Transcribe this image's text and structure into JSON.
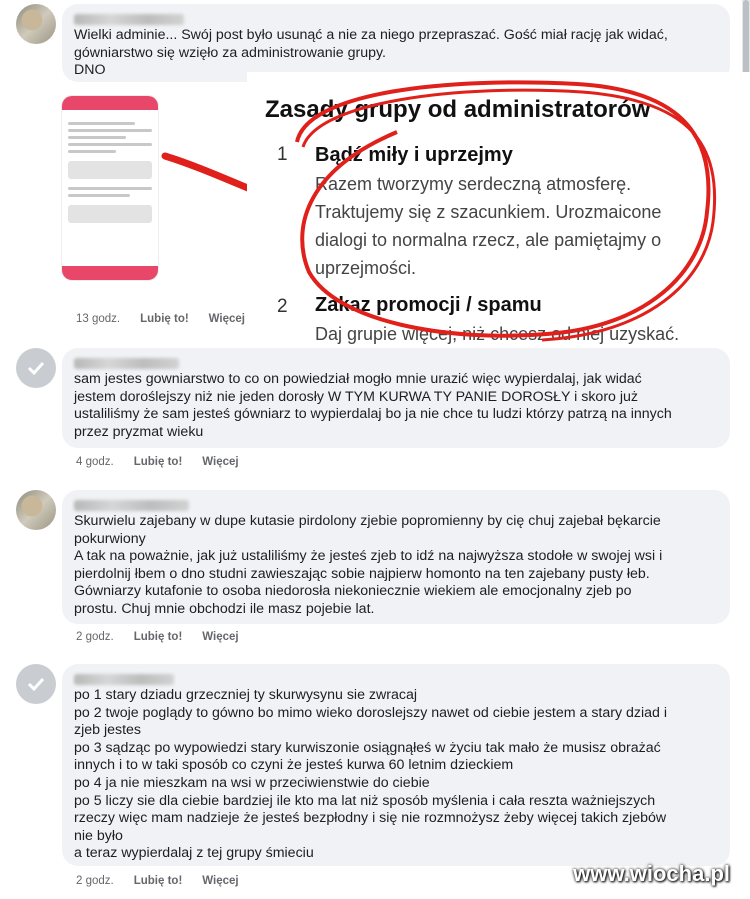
{
  "comments": [
    {
      "avatar": "photo",
      "text": "Wielki adminie... Swój post było usunąć a nie za niego przepraszać. Gość miał rację jak widać,\ngówniarstwo się wzięło za administrowanie grupy.\nDNO",
      "time": "13 godz.",
      "like": "Lubię to!",
      "more": "Więcej"
    },
    {
      "avatar": "default",
      "text": "sam jestes gowniarstwo to co on powiedział mogło mnie urazić więc wypierdalaj, jak widać\njestem doroślejszy niż nie jeden dorosły W TYM KURWA TY PANIE DOROSŁY i skoro już\nustaliliśmy że sam jesteś gówniarz to wypierdalaj bo ja nie chce tu ludzi którzy patrzą na innych\nprzez pryzmat wieku",
      "time": "4 godz.",
      "like": "Lubię to!",
      "more": "Więcej"
    },
    {
      "avatar": "photo",
      "text": "Skurwielu zajebany w dupe kutasie pirdolony zjebie popromienny by cię chuj zajebał bękarcie\npokurwiony\nA tak na poważnie, jak już ustaliliśmy że jesteś zjeb to idź na najwyższa stodołe w swojej wsi i\npierdolnij łbem o dno studni zawieszając sobie najpierw homonto na ten zajebany pusty łeb.\nGówniarzy kutafonie to osoba niedorosła niekoniecznie wiekiem ale emocjonalny zjeb po\nprostu. Chuj mnie obchodzi ile masz pojebie lat.",
      "time": "2 godz.",
      "like": "Lubię to!",
      "more": "Więcej"
    },
    {
      "avatar": "default",
      "text": "po 1 stary dziadu grzeczniej ty skurwysynu sie zwracaj\npo 2 twoje poglądy to gówno bo mimo wieko doroslejszy nawet od ciebie jestem a stary dziad i\nzjeb jestes\npo 3 sądząc po wypowiedzi stary kurwiszonie osiągnąłeś w życiu tak mało że musisz obrażać\ninnych i to w taki sposób co czyni że jesteś kurwa 60 letnim dzieckiem\npo 4 ja nie mieszkam na wsi w przeciwienstwie do ciebie\npo 5 liczy sie dla ciebie bardziej ile kto ma lat niż sposób myślenia i cała reszta ważniejszych\nrzeczy więc mam nadzieje że jesteś bezpłodny i się nie rozmnożysz żeby więcej takich zjebów\nnie było\na teraz wypierdalaj z tej grupy śmieciu",
      "time": "2 godz.",
      "like": "Lubię to!",
      "more": "Więcej"
    }
  ],
  "screenshot": {
    "title": "Zasady grupy od administratorów",
    "rules": [
      {
        "num": "1",
        "heading": "Bądź miły i uprzejmy",
        "body": "Razem tworzymy serdeczną atmosferę.\nTraktujemy się z szacunkiem. Urozmaicone\ndialogi to normalna rzecz, ale pamiętajmy o\nuprzejmości."
      },
      {
        "num": "2",
        "heading": "Zakaz promocji / spamu",
        "body": "Daj grupie więcej, niż chcesz od niej uzyskać."
      }
    ],
    "annotation_color": "#e0201b"
  },
  "watermark": "www.wiocha.pl"
}
